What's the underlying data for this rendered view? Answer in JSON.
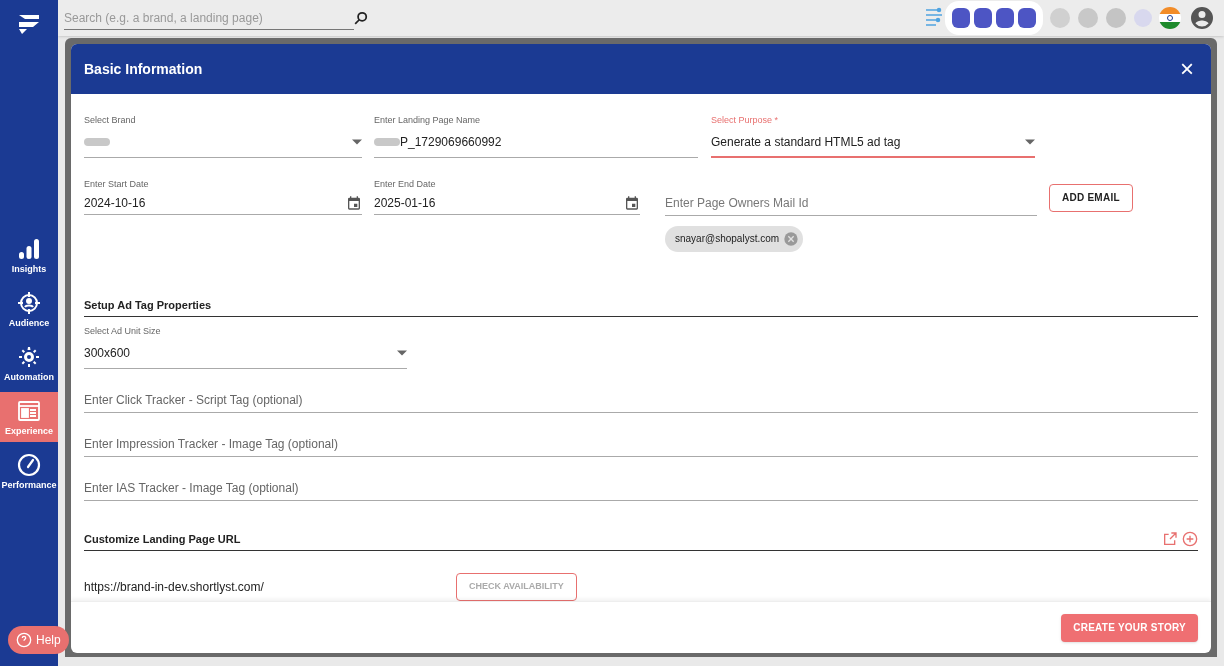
{
  "search": {
    "placeholder": "Search (e.g. a brand, a landing page)"
  },
  "sidebar": {
    "items": [
      {
        "label": "Insights",
        "selected": false
      },
      {
        "label": "Audience",
        "selected": false
      },
      {
        "label": "Automation",
        "selected": false
      },
      {
        "label": "Experience",
        "selected": true
      },
      {
        "label": "Performance",
        "selected": false
      }
    ]
  },
  "help": {
    "label": "Help"
  },
  "dialog": {
    "title": "Basic Information",
    "close": "×",
    "fields_row1": [
      {
        "kind": "select",
        "label": "Select Brand",
        "blurred": true,
        "focused": false
      },
      {
        "kind": "text",
        "label": "Enter Landing Page Name",
        "value": "P_1729069660992",
        "blurred": true,
        "focused": false
      },
      {
        "kind": "select",
        "label": "Select Purpose *",
        "value": "Generate a standard HTML5 ad tag",
        "blurred": false,
        "focused": true
      }
    ],
    "start_date": {
      "label": "Enter Start Date",
      "value": "2024-10-16"
    },
    "end_date": {
      "label": "Enter End Date",
      "value": "2025-01-16"
    },
    "owner_email": {
      "placeholder": "Enter Page Owners Mail Id",
      "button": "ADD EMAIL",
      "chips": [
        "snayar@shopalyst.com"
      ]
    },
    "ad_tag": {
      "heading": "Setup Ad Tag Properties",
      "size_label": "Select Ad Unit Size",
      "size_value": "300x600",
      "trackers": [
        {
          "placeholder": "Enter Click Tracker - Script Tag (optional)"
        },
        {
          "placeholder": "Enter Impression Tracker - Image Tag (optional)"
        },
        {
          "placeholder": "Enter IAS Tracker - Image Tag (optional)"
        }
      ]
    },
    "url": {
      "heading": "Customize Landing Page URL",
      "prefix": "https://brand-in-dev.shortlyst.com/",
      "check_button": "CHECK AVAILABILITY"
    },
    "submit": "CREATE YOUR STORY"
  }
}
